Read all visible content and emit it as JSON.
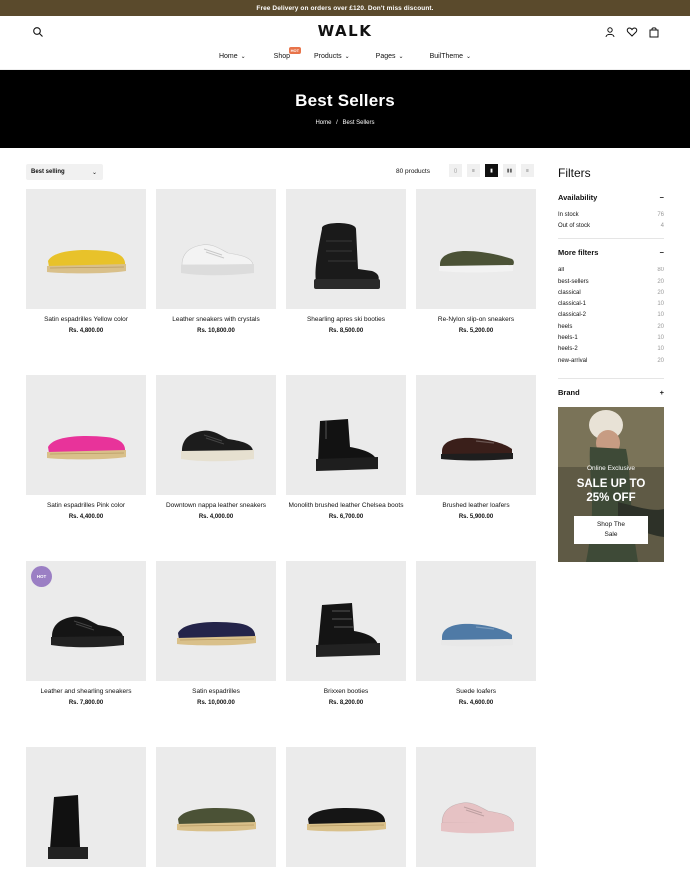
{
  "announcement": "Free Delivery on orders over £120. Don't miss discount.",
  "logo": "WALK",
  "nav": [
    {
      "label": "Home",
      "has_badge": false
    },
    {
      "label": "Shop",
      "has_badge": true,
      "badge": "HOT"
    },
    {
      "label": "Products",
      "has_badge": false
    },
    {
      "label": "Pages",
      "has_badge": false
    },
    {
      "label": "BuilTheme",
      "has_badge": false
    }
  ],
  "hero": {
    "title": "Best Sellers",
    "crumb_home": "Home",
    "crumb_sep": "/",
    "crumb_current": "Best Sellers"
  },
  "toolbar": {
    "sort_value": "Best selling",
    "count": "80 products"
  },
  "products": [
    {
      "name": "Satin espadrilles Yellow color",
      "price": "Rs. 4,800.00",
      "shoe": "espadrille",
      "color": "#e8c22a",
      "sole": "#d9c08a",
      "hot": false
    },
    {
      "name": "Leather sneakers with crystals",
      "price": "Rs. 10,800.00",
      "shoe": "sneaker",
      "color": "#f3f3f3",
      "sole": "#dcdcdc",
      "hot": false
    },
    {
      "name": "Shearling apres ski booties",
      "price": "Rs. 8,500.00",
      "shoe": "snowboot",
      "color": "#1a1a1a",
      "sole": "#2a2a2a",
      "hot": false
    },
    {
      "name": "Re-Nylon slip-on sneakers",
      "price": "Rs. 5,200.00",
      "shoe": "slipon",
      "color": "#4b5236",
      "sole": "#f2f2f2",
      "hot": false
    },
    {
      "name": "Satin espadrilles Pink color",
      "price": "Rs. 4,400.00",
      "shoe": "espadrille",
      "color": "#e8339a",
      "sole": "#d9c08a",
      "hot": false
    },
    {
      "name": "Downtown nappa leather sneakers",
      "price": "Rs. 4,000.00",
      "shoe": "sneaker",
      "color": "#1c1c1c",
      "sole": "#e6e0d0",
      "hot": false
    },
    {
      "name": "Monolith brushed leather Chelsea boots",
      "price": "Rs. 6,700.00",
      "shoe": "chelsea",
      "color": "#121212",
      "sole": "#1e1e1e",
      "hot": false
    },
    {
      "name": "Brushed leather loafers",
      "price": "Rs. 5,900.00",
      "shoe": "loafer",
      "color": "#3a1f1a",
      "sole": "#1e1e1e",
      "hot": false
    },
    {
      "name": "Leather and shearling sneakers",
      "price": "Rs. 7,800.00",
      "shoe": "sneaker",
      "color": "#151515",
      "sole": "#222222",
      "hot": true,
      "hot_label": "HOT"
    },
    {
      "name": "Satin espadrilles",
      "price": "Rs. 10,000.00",
      "shoe": "espadrille",
      "color": "#24244a",
      "sole": "#d9c08a",
      "hot": false
    },
    {
      "name": "Brixxen booties",
      "price": "Rs. 8,200.00",
      "shoe": "hiker",
      "color": "#141414",
      "sole": "#222222",
      "hot": false
    },
    {
      "name": "Suede loafers",
      "price": "Rs. 4,600.00",
      "shoe": "loafer",
      "color": "#4f7aa6",
      "sole": "#e8e8e8",
      "hot": false
    },
    {
      "name": "",
      "price": "",
      "shoe": "combat",
      "color": "#111111",
      "sole": "#222222",
      "hot": false
    },
    {
      "name": "",
      "price": "",
      "shoe": "espadrille",
      "color": "#4b5236",
      "sole": "#d9c08a",
      "hot": false
    },
    {
      "name": "",
      "price": "",
      "shoe": "espadrille",
      "color": "#151515",
      "sole": "#d9c08a",
      "hot": false
    },
    {
      "name": "",
      "price": "",
      "shoe": "sneaker",
      "color": "#e6c2c4",
      "sole": "#e6c2c4",
      "hot": false
    }
  ],
  "filters": {
    "title": "Filters",
    "availability_label": "Availability",
    "availability": [
      {
        "label": "In stock",
        "count": "76"
      },
      {
        "label": "Out of stock",
        "count": "4"
      }
    ],
    "more_label": "More filters",
    "more": [
      {
        "label": "all",
        "count": "80"
      },
      {
        "label": "best-sellers",
        "count": "20"
      },
      {
        "label": "classical",
        "count": "20"
      },
      {
        "label": "classical-1",
        "count": "10"
      },
      {
        "label": "classical-2",
        "count": "10"
      },
      {
        "label": "heels",
        "count": "20"
      },
      {
        "label": "heels-1",
        "count": "10"
      },
      {
        "label": "heels-2",
        "count": "10"
      },
      {
        "label": "new-arrival",
        "count": "20"
      }
    ],
    "brand_label": "Brand",
    "collapse_symbol": "−",
    "expand_symbol": "+"
  },
  "promo": {
    "eyebrow": "Online Exclusive",
    "headline_1": "SALE UP TO",
    "headline_2": "25% OFF",
    "button_1": "Shop The",
    "button_2": "Sale"
  },
  "icons": {
    "search": "search-icon",
    "account": "user-icon",
    "wishlist": "heart-icon",
    "cart": "bag-icon"
  }
}
